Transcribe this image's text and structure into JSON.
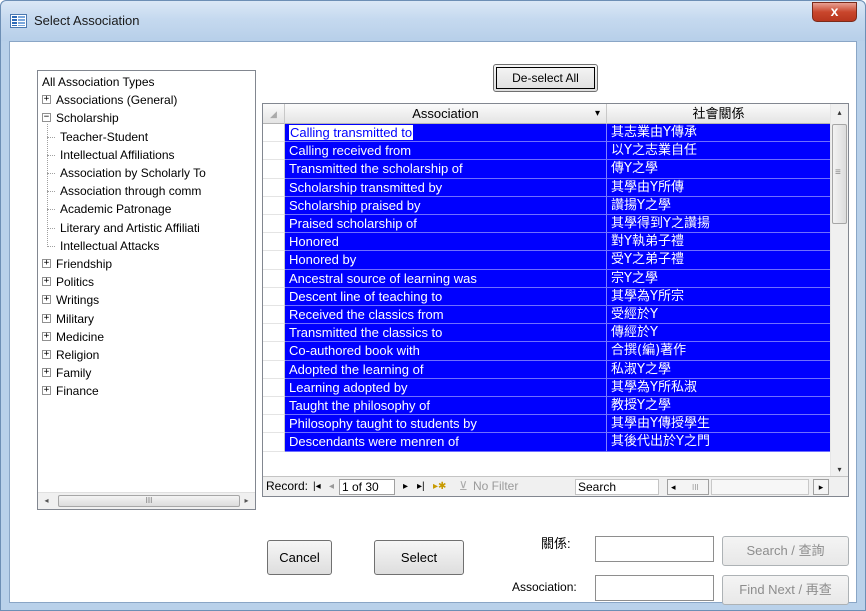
{
  "window": {
    "title": "Select Association",
    "close_glyph": "x"
  },
  "tree": {
    "root": "All Association Types",
    "groups": [
      {
        "label": "Associations (General)",
        "sign": "+"
      },
      {
        "label": "Scholarship",
        "sign": "−"
      },
      {
        "label": "Friendship",
        "sign": "+"
      },
      {
        "label": "Politics",
        "sign": "+"
      },
      {
        "label": "Writings",
        "sign": "+"
      },
      {
        "label": "Military",
        "sign": "+"
      },
      {
        "label": "Medicine",
        "sign": "+"
      },
      {
        "label": "Religion",
        "sign": "+"
      },
      {
        "label": "Family",
        "sign": "+"
      },
      {
        "label": "Finance",
        "sign": "+"
      }
    ],
    "scholarship_children": [
      "Teacher-Student",
      "Intellectual Affiliations",
      "Association by Scholarly To",
      "Association through comm",
      "Academic Patronage",
      "Literary and Artistic Affiliati",
      "Intellectual Attacks"
    ],
    "scroll_left": "◂",
    "scroll_right": "▸",
    "scroll_grip": "III"
  },
  "toolbar": {
    "deselect_all": "De-select All"
  },
  "grid": {
    "columns": [
      "Association",
      "社會關係"
    ],
    "sort_glyph": "▾",
    "rows": [
      [
        "Calling transmitted to",
        "其志業由Y傳承"
      ],
      [
        "Calling received from",
        "以Y之志業自任"
      ],
      [
        "Transmitted the scholarship of",
        "傳Y之學"
      ],
      [
        "Scholarship transmitted by",
        "其學由Y所傳"
      ],
      [
        "Scholarship praised by",
        "讚揚Y之學"
      ],
      [
        "Praised scholarship of",
        "其學得到Y之讚揚"
      ],
      [
        "Honored",
        "對Y執弟子禮"
      ],
      [
        "Honored by",
        "受Y之弟子禮"
      ],
      [
        "Ancestral source of learning was",
        "宗Y之學"
      ],
      [
        "Descent line of teaching to",
        "其學為Y所宗"
      ],
      [
        "Received the classics from",
        "受經於Y"
      ],
      [
        "Transmitted the classics to",
        "傳經於Y"
      ],
      [
        "Co-authored book with",
        "合撰(編)著作"
      ],
      [
        "Adopted the learning of",
        "私淑Y之學"
      ],
      [
        "Learning adopted by",
        "其學為Y所私淑"
      ],
      [
        "Taught the philosophy of",
        "教授Y之學"
      ],
      [
        "Philosophy taught to students by",
        "其學由Y傳授學生"
      ],
      [
        "Descendants were menren of",
        "其後代出於Y之門"
      ]
    ],
    "vscroll_up": "▴",
    "vscroll_down": "▾",
    "vscroll_grip": "≡",
    "nav": {
      "record_label": "Record:",
      "first": "|◂",
      "prev": "◂",
      "position": "1 of 30",
      "next": "▸",
      "last": "▸|",
      "new": "▸✱",
      "filter_icon": "⊻",
      "filter": "No Filter",
      "search": "Search",
      "hs_left": "◂",
      "hs_right": "▸",
      "hs_grip": "III"
    }
  },
  "footer": {
    "cancel": "Cancel",
    "select": "Select",
    "guanxi_label": "關係:",
    "association_label": "Association:",
    "search_button": "Search / 查詢",
    "find_next_button": "Find Next / 再查"
  }
}
